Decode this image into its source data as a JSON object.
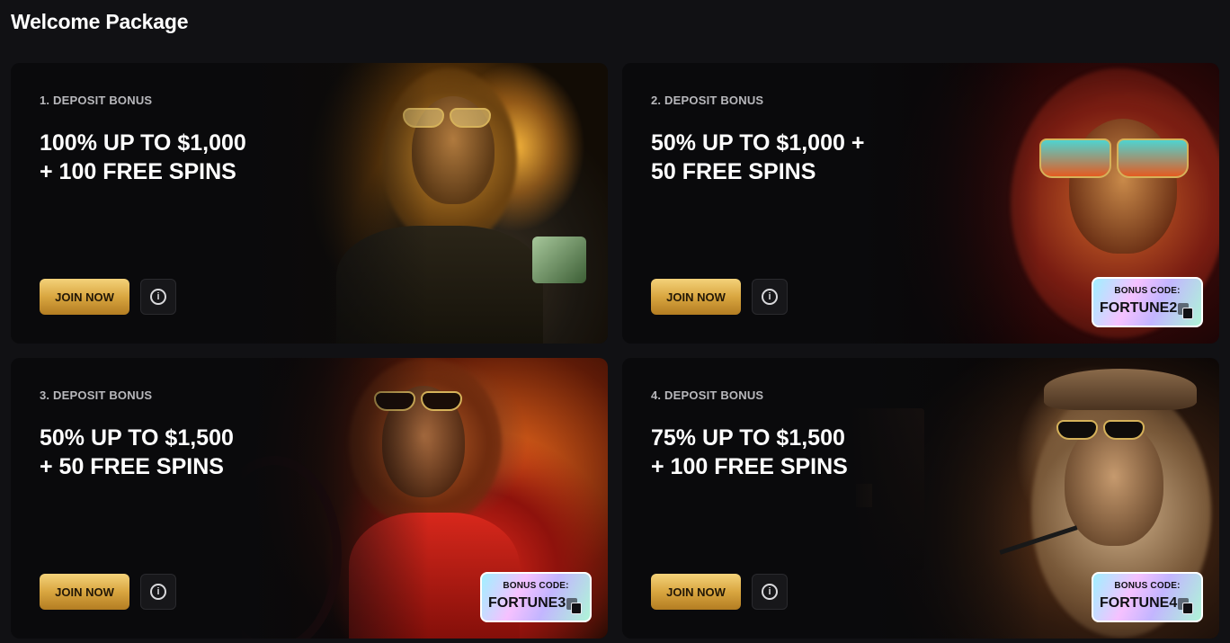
{
  "page": {
    "title": "Welcome Package"
  },
  "cards": [
    {
      "label": "1. DEPOSIT BONUS",
      "line1": "100% UP TO $1,000",
      "line2": "+ 100 FREE SPINS",
      "join_label": "JOIN NOW",
      "info_glyph": "i",
      "bonus_code": null
    },
    {
      "label": "2. DEPOSIT BONUS",
      "line1": "50% UP TO $1,000 +",
      "line2": "50 FREE SPINS",
      "join_label": "JOIN NOW",
      "info_glyph": "i",
      "bonus_code": {
        "caption": "BONUS CODE:",
        "code": "FORTUNE2"
      }
    },
    {
      "label": "3. DEPOSIT BONUS",
      "line1": "50% UP TO $1,500",
      "line2": "+ 50 FREE SPINS",
      "join_label": "JOIN NOW",
      "info_glyph": "i",
      "bonus_code": {
        "caption": "BONUS CODE:",
        "code": "FORTUNE3"
      }
    },
    {
      "label": "4. DEPOSIT BONUS",
      "line1": "75% UP TO $1,500",
      "line2": "+ 100 FREE SPINS",
      "join_label": "JOIN NOW",
      "info_glyph": "i",
      "bonus_code": {
        "caption": "BONUS CODE:",
        "code": "FORTUNE4"
      }
    }
  ],
  "colors": {
    "background": "#111114",
    "card": "#0b0b0d",
    "gold_button": "#d9a640",
    "label": "#b8b8bc"
  },
  "icons": {
    "info": "info-circle-icon",
    "copy": "copy-icon"
  }
}
